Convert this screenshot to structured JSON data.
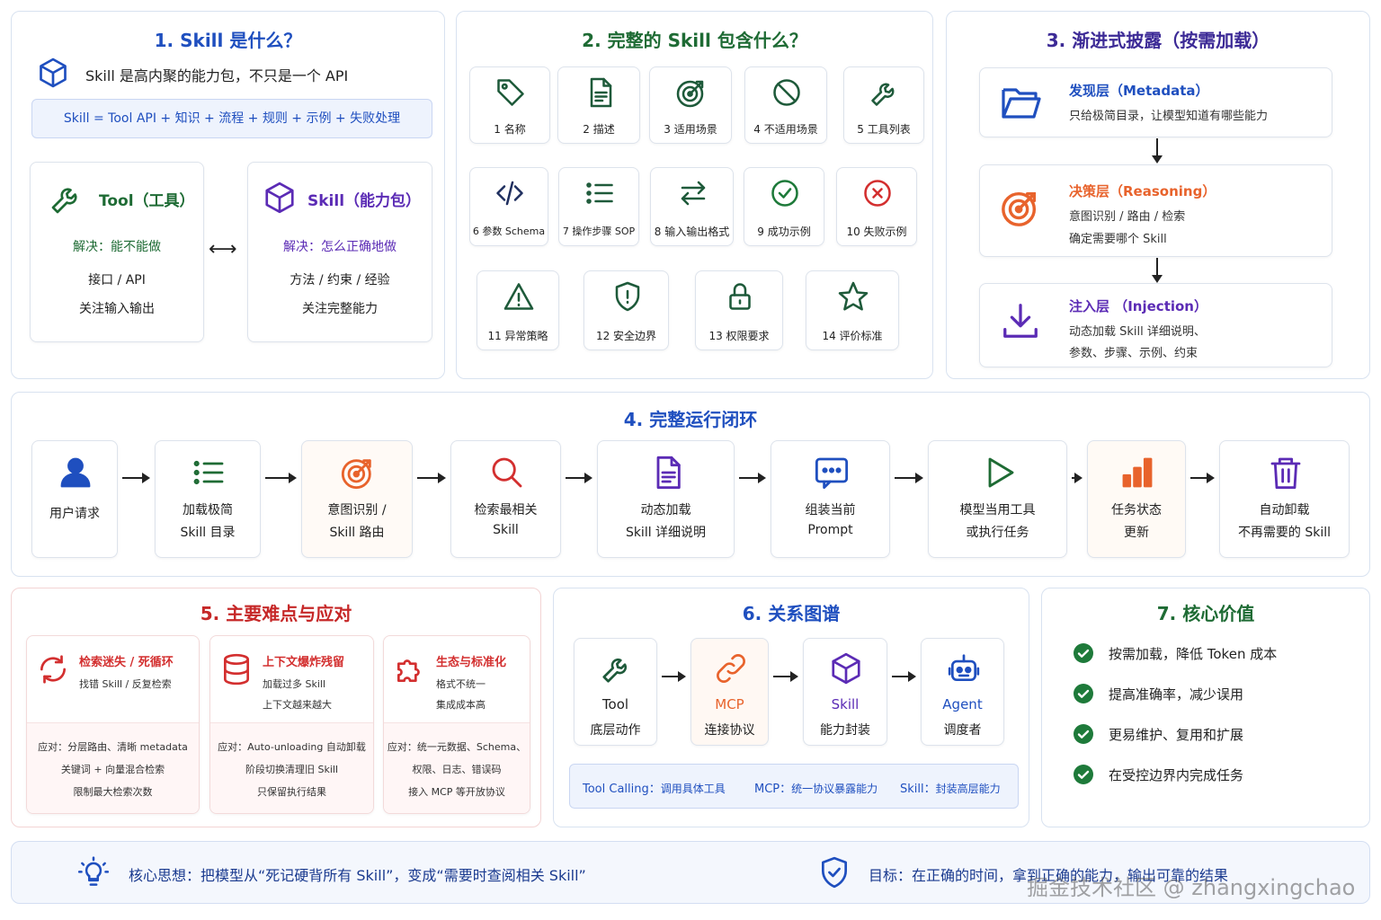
{
  "colors": {
    "blue": "#1f4fbf",
    "green": "#1e6b34",
    "purple": "#5b2bb5",
    "orange": "#e8632c",
    "red": "#d32f2f",
    "ok": "#1e7a3a"
  },
  "p1": {
    "title": "1. Skill 是什么？",
    "intro": "Skill 是高内聚的能力包，不只是一个 API",
    "formula": "Skill = Tool API + 知识 + 流程 + 规则 + 示例 + 失败处理",
    "tool": {
      "name": "Tool（工具）",
      "solve": "解决：能不能做",
      "l1": "接口 / API",
      "l2": "关注输入输出"
    },
    "skill": {
      "name": "Skill（能力包）",
      "solve": "解决：怎么正确地做",
      "l1": "方法 / 约束 / 经验",
      "l2": "关注完整能力"
    }
  },
  "p2": {
    "title": "2. 完整的 Skill 包含什么？",
    "items": [
      {
        "label": "1 名称",
        "icon": "tag-icon"
      },
      {
        "label": "2 描述",
        "icon": "document-icon"
      },
      {
        "label": "3 适用场景",
        "icon": "target-icon"
      },
      {
        "label": "4 不适用场景",
        "icon": "ban-icon"
      },
      {
        "label": "5 工具列表",
        "icon": "wrench-icon"
      },
      {
        "label": "6 参数 Schema",
        "icon": "code-icon"
      },
      {
        "label": "7 操作步骤 SOP",
        "icon": "list-icon"
      },
      {
        "label": "8 输入输出格式",
        "icon": "swap-icon"
      },
      {
        "label": "9 成功示例",
        "icon": "check-circle-icon"
      },
      {
        "label": "10 失败示例",
        "icon": "x-circle-icon"
      },
      {
        "label": "11 异常策略",
        "icon": "warning-icon"
      },
      {
        "label": "12 安全边界",
        "icon": "shield-icon"
      },
      {
        "label": "13 权限要求",
        "icon": "lock-icon"
      },
      {
        "label": "14 评价标准",
        "icon": "star-icon"
      }
    ]
  },
  "p3": {
    "title": "3. 渐进式披露（按需加载）",
    "layers": [
      {
        "name": "发现层（Metadata）",
        "lines": [
          "只给极简目录，让模型知道有哪些能力"
        ],
        "icon": "folder-icon"
      },
      {
        "name": "决策层（Reasoning）",
        "lines": [
          "意图识别 / 路由 / 检索",
          "确定需要哪个 Skill"
        ],
        "icon": "target-icon"
      },
      {
        "name": "注入层 （Injection）",
        "lines": [
          "动态加载 Skill 详细说明、",
          "参数、步骤、示例、约束"
        ],
        "icon": "download-icon"
      }
    ]
  },
  "p4": {
    "title": "4. 完整运行闭环",
    "steps": [
      {
        "l1": "用户请求",
        "l2": "",
        "icon": "user-icon"
      },
      {
        "l1": "加载极简",
        "l2": "Skill 目录",
        "icon": "list-icon"
      },
      {
        "l1": "意图识别 /",
        "l2": "Skill 路由",
        "icon": "target-icon"
      },
      {
        "l1": "检索最相关",
        "l2": "Skill",
        "icon": "search-icon"
      },
      {
        "l1": "动态加载",
        "l2": "Skill 详细说明",
        "icon": "document-icon"
      },
      {
        "l1": "组装当前",
        "l2": "Prompt",
        "icon": "message-icon"
      },
      {
        "l1": "模型当用工具",
        "l2": "或执行任务",
        "icon": "play-icon"
      },
      {
        "l1": "任务状态",
        "l2": "更新",
        "icon": "bar-chart-icon"
      },
      {
        "l1": "自动卸载",
        "l2": "不再需要的 Skill",
        "icon": "trash-icon"
      }
    ]
  },
  "p5": {
    "title": "5. 主要难点与应对",
    "items": [
      {
        "name": "检索迷失 / 死循环",
        "d1": "找错 Skill / 反复检索",
        "d2": "",
        "r1": "应对：分层路由、清晰 metadata",
        "r2": "关键词 + 向量混合检索",
        "r3": "限制最大检索次数",
        "icon": "refresh-icon"
      },
      {
        "name": "上下文爆炸残留",
        "d1": "加载过多 Skill",
        "d2": "上下文越来越大",
        "r1": "应对：Auto-unloading 自动卸载",
        "r2": "阶段切换清理旧 Skill",
        "r3": "只保留执行结果",
        "icon": "database-icon"
      },
      {
        "name": "生态与标准化",
        "d1": "格式不统一",
        "d2": "集成成本高",
        "r1": "应对：统一元数据、Schema、",
        "r2": "权限、日志、错误码",
        "r3": "接入 MCP 等开放协议",
        "icon": "puzzle-icon"
      }
    ]
  },
  "p6": {
    "title": "6. 关系图谱",
    "nodes": [
      {
        "name": "Tool",
        "desc": "底层动作",
        "icon": "wrench-icon"
      },
      {
        "name": "MCP",
        "desc": "连接协议",
        "icon": "link-icon"
      },
      {
        "name": "Skill",
        "desc": "能力封装",
        "icon": "cube-icon"
      },
      {
        "name": "Agent",
        "desc": "调度者",
        "icon": "robot-icon"
      }
    ],
    "legend": [
      {
        "key": "Tool Calling：",
        "val": "调用具体工具"
      },
      {
        "key": "MCP：",
        "val": "统一协议暴露能力"
      },
      {
        "key": "Skill：",
        "val": "封装高层能力"
      }
    ]
  },
  "p7": {
    "title": "7. 核心价值",
    "items": [
      "按需加载，降低 Token 成本",
      "提高准确率，减少误用",
      "更易维护、复用和扩展",
      "在受控边界内完成任务"
    ]
  },
  "footer": {
    "idea": "核心思想：把模型从“死记硬背所有 Skill”，变成“需要时查阅相关 Skill”",
    "goal": "目标：在正确的时间，拿到正确的能力，输出可靠的结果",
    "watermark": "掘金技术社区 @ zhangxingchao"
  }
}
